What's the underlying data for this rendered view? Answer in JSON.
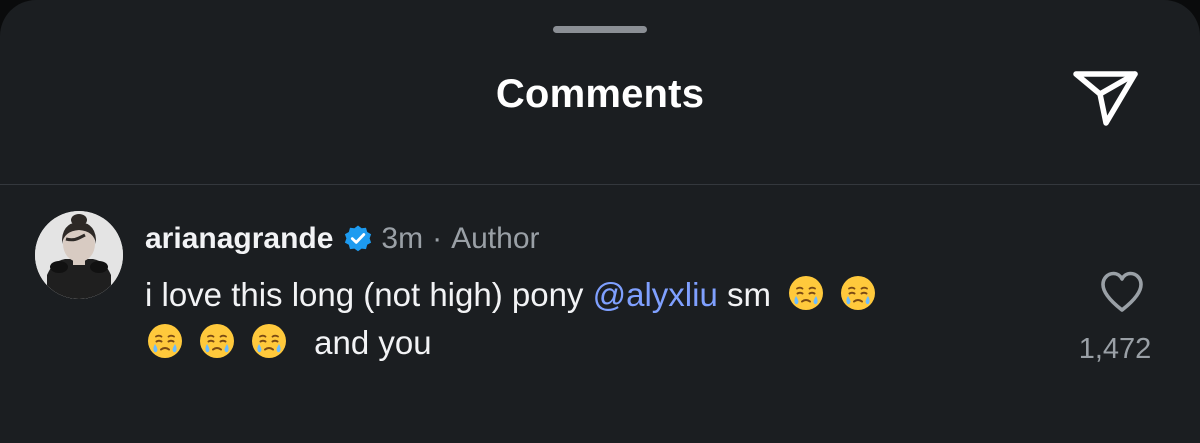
{
  "header": {
    "title": "Comments",
    "share_icon": "send-paper-plane-icon"
  },
  "comment": {
    "username": "arianagrande",
    "verified_icon": "verified-badge-icon",
    "time": "3m",
    "separator": "·",
    "role": "Author",
    "text_part1": "i love this long (not high) pony",
    "mention": "@alyxliu",
    "text_part2": "sm",
    "emoji_name": "face-holding-back-tears",
    "emoji_count": 5,
    "text_part3": "and you",
    "like_icon": "heart-outline-icon",
    "like_count": "1,472"
  },
  "colors": {
    "background": "#1b1e21",
    "text": "#f2f3f5",
    "muted": "#9aa0a6",
    "mention": "#7fa0ff",
    "verified": "#1d9bf0"
  }
}
